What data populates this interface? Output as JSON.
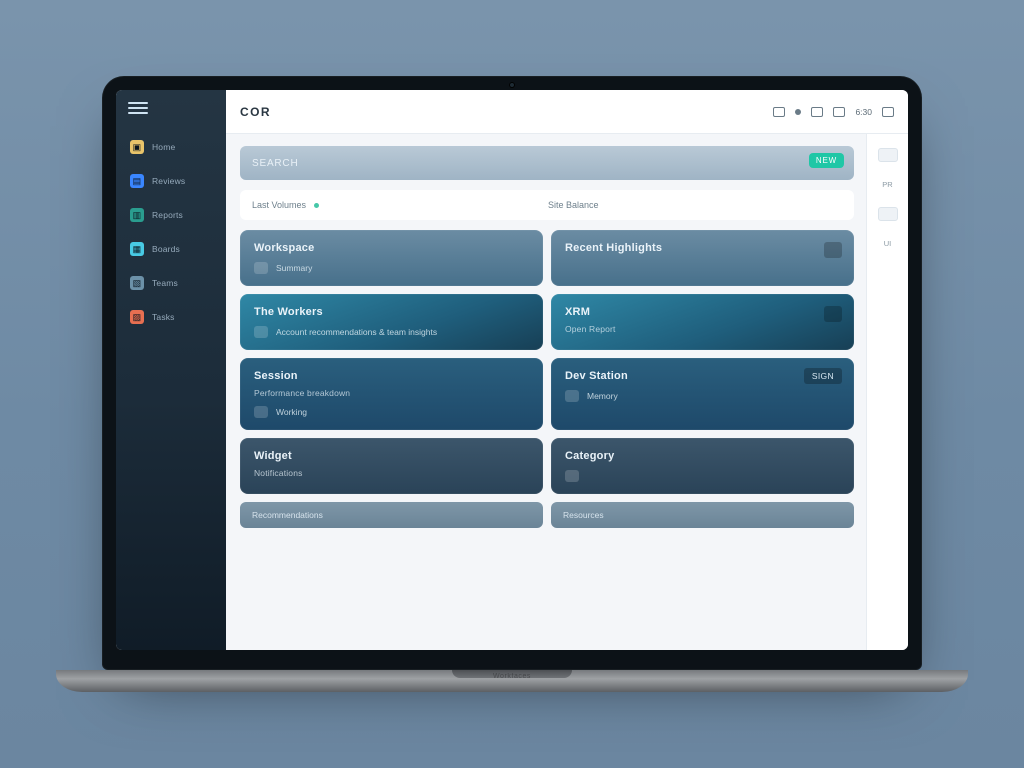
{
  "statusbar": {
    "time": "6:30"
  },
  "header": {
    "brand": "COR"
  },
  "sidebar": {
    "items": [
      {
        "label": "Home"
      },
      {
        "label": "Reviews"
      },
      {
        "label": "Reports"
      },
      {
        "label": "Boards"
      },
      {
        "label": "Teams"
      },
      {
        "label": "Tasks"
      }
    ]
  },
  "search": {
    "label": "SEARCH",
    "badge": "NEW"
  },
  "dualhead": {
    "left": "Last Volumes",
    "right": "Site Balance"
  },
  "cards": {
    "r1": {
      "left": {
        "title": "Workspace",
        "sub": "Summary",
        "note": ""
      },
      "right": {
        "title": "Recent Highlights",
        "sub": "",
        "note": ""
      }
    },
    "r2": {
      "left": {
        "title": "The Workers",
        "sub": "Account recommendations & team insights",
        "note": ""
      },
      "right": {
        "title": "XRM",
        "sub": "Open Report",
        "note": ""
      }
    },
    "r3": {
      "left": {
        "title": "Session",
        "sub": "Performance breakdown",
        "foot": "Working"
      },
      "right": {
        "title": "Dev Station",
        "sub": "",
        "foot": "Memory",
        "tag": "SIGN"
      }
    },
    "r4": {
      "left": {
        "title": "Widget",
        "sub": "Notifications",
        "foot": ""
      },
      "right": {
        "title": "Category",
        "sub": "",
        "foot": ""
      }
    }
  },
  "footer": {
    "left": "Recommendations",
    "right": "Resources"
  },
  "rail": {
    "a": "PR",
    "b": "UI"
  },
  "laptop": {
    "brand": "Workfaces"
  }
}
